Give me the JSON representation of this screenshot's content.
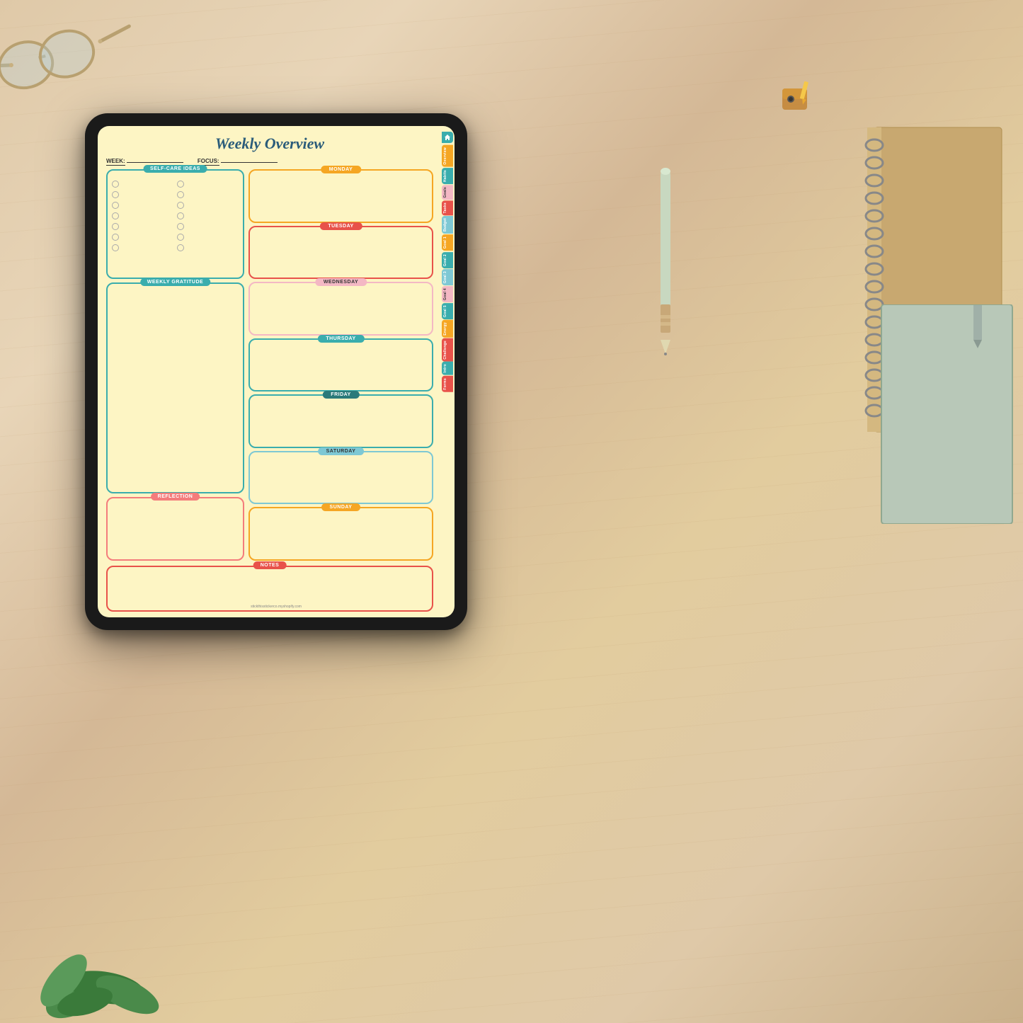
{
  "desk": {
    "bg_color": "#e2cc9e"
  },
  "planner": {
    "title": "Weekly Overview",
    "week_label": "WEEK:",
    "focus_label": "FOCUS:",
    "sections": {
      "self_care": "SELF-CARE IDEAS",
      "gratitude": "WEEKLY GRATITUDE",
      "reflection": "REFLECTION",
      "notes": "NOTES",
      "monday": "MONDAY",
      "tuesday": "TUESDAY",
      "wednesday": "WEDNESDAY",
      "thursday": "THURSDAY",
      "friday": "FRIDAY",
      "saturday": "SATURDAY",
      "sunday": "SUNDAY"
    },
    "tabs": [
      {
        "label": "Index",
        "color": "#3aadad"
      },
      {
        "label": "Overview",
        "color": "#f5a623"
      },
      {
        "label": "Habits",
        "color": "#3aadad"
      },
      {
        "label": "Goals",
        "color": "#f4b8c4"
      },
      {
        "label": "Tasks",
        "color": "#e8524a"
      },
      {
        "label": "Budget",
        "color": "#7ec8d4"
      },
      {
        "label": "Goal 1",
        "color": "#f5a623"
      },
      {
        "label": "Goal 2",
        "color": "#3aadad"
      },
      {
        "label": "Goal 3",
        "color": "#7ec8d4"
      },
      {
        "label": "Goal 4",
        "color": "#f4b8c4"
      },
      {
        "label": "Goal 5",
        "color": "#3aadad"
      },
      {
        "label": "Energy",
        "color": "#f5a623"
      },
      {
        "label": "Challenge",
        "color": "#e8524a"
      },
      {
        "label": "Intro",
        "color": "#3aadad"
      },
      {
        "label": "Forms",
        "color": "#e8524a"
      }
    ],
    "website": "stickthisstickerco.myshopify.com"
  }
}
